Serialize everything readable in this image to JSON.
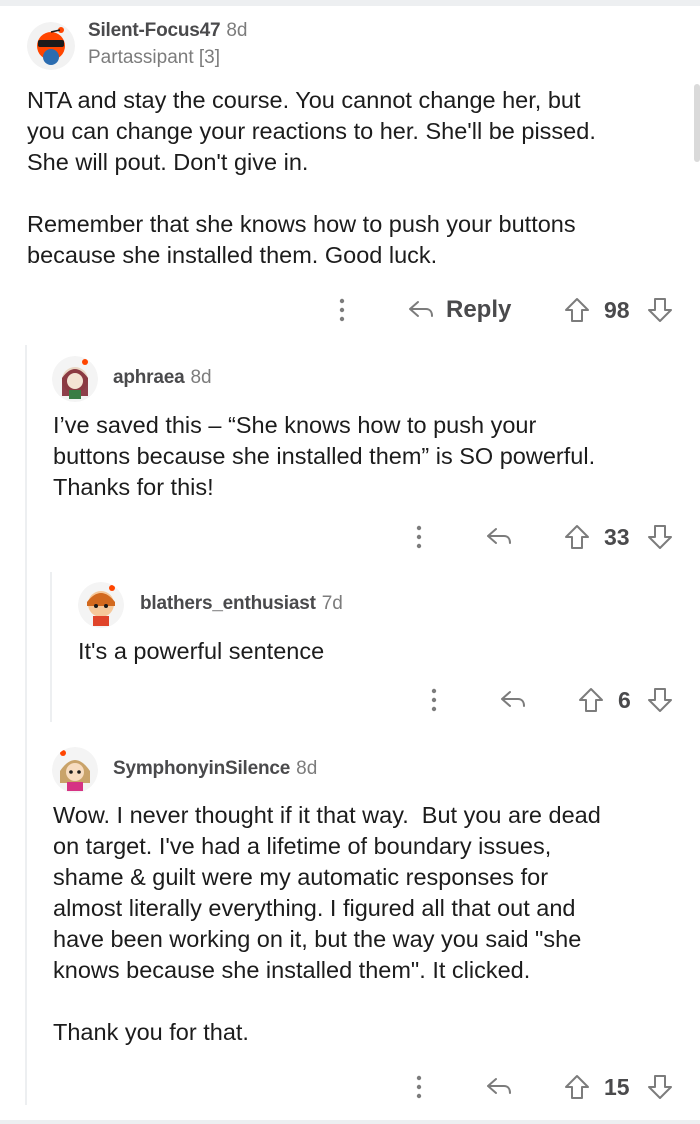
{
  "comments": [
    {
      "username": "Silent-Focus47",
      "age": "8d",
      "flair": "Partassipant [3]",
      "body": "NTA and stay the course. You cannot change her, but\nyou can change your reactions to her. She'll be pissed.\nShe will pout. Don't give in.\n\nRemember that she knows how to push your buttons\nbecause she installed them. Good luck.",
      "reply_label": "Reply",
      "score": "98"
    },
    {
      "username": "aphraea",
      "age": "8d",
      "body": "I’ve saved this – “She knows how to push your\nbuttons because she installed them” is SO powerful.\nThanks for this!",
      "score": "33"
    },
    {
      "username": "blathers_enthusiast",
      "age": "7d",
      "body": "It's a powerful sentence",
      "score": "6"
    },
    {
      "username": "SymphonyinSilence",
      "age": "8d",
      "body": "Wow. I never thought if it that way.  But you are dead\non target. I've had a lifetime of boundary issues,\nshame & guilt were my automatic responses for\nalmost literally everything. I figured all that out and\nhave been working on it, but the way you said \"she\nknows because she installed them\". It clicked.\n\nThank you for that.",
      "score": "15"
    }
  ],
  "icons": {
    "more": "more-options-icon",
    "reply": "reply-arrow-icon",
    "upvote": "upvote-arrow-icon",
    "downvote": "downvote-arrow-icon"
  },
  "colors": {
    "thread_line": "#edeff1",
    "meta_gray": "#7c7c7c",
    "text": "#1c1c1c"
  }
}
